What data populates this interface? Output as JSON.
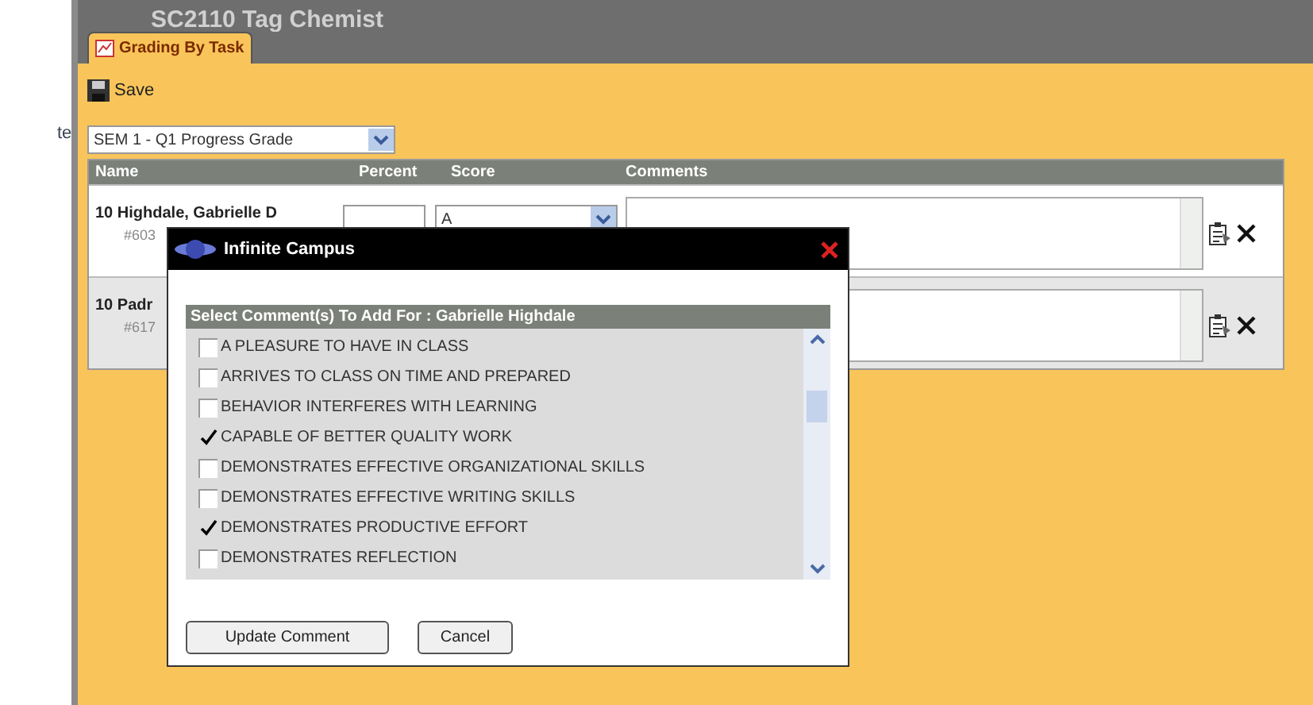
{
  "page_title": "SC2110 Tag Chemist",
  "side_text": "te",
  "tabs": [
    {
      "label": "Grading By Task",
      "selected": true
    }
  ],
  "save_button": "Save",
  "task_select": {
    "value": "SEM 1 - Q1 Progress Grade"
  },
  "table": {
    "columns": [
      "Name",
      "Percent",
      "Score",
      "Comments"
    ],
    "rows": [
      {
        "name": "10 Highdale, Gabrielle D",
        "student_id": "#603",
        "score": "A"
      },
      {
        "name": "10 Padr",
        "student_id": "#617"
      }
    ]
  },
  "dialog": {
    "title": "Infinite Campus",
    "list_header": "Select Comment(s) To Add For : Gabrielle Highdale",
    "comments": [
      {
        "label": "A PLEASURE TO HAVE IN CLASS",
        "checked": false
      },
      {
        "label": "ARRIVES TO CLASS ON TIME AND PREPARED",
        "checked": false
      },
      {
        "label": "BEHAVIOR INTERFERES WITH LEARNING",
        "checked": false
      },
      {
        "label": "CAPABLE OF BETTER QUALITY WORK",
        "checked": true
      },
      {
        "label": "DEMONSTRATES EFFECTIVE ORGANIZATIONAL SKILLS",
        "checked": false
      },
      {
        "label": "DEMONSTRATES EFFECTIVE WRITING SKILLS",
        "checked": false
      },
      {
        "label": "DEMONSTRATES PRODUCTIVE EFFORT",
        "checked": true
      },
      {
        "label": "DEMONSTRATES REFLECTION",
        "checked": false
      }
    ],
    "buttons": [
      "Update Comment",
      "Cancel"
    ]
  }
}
